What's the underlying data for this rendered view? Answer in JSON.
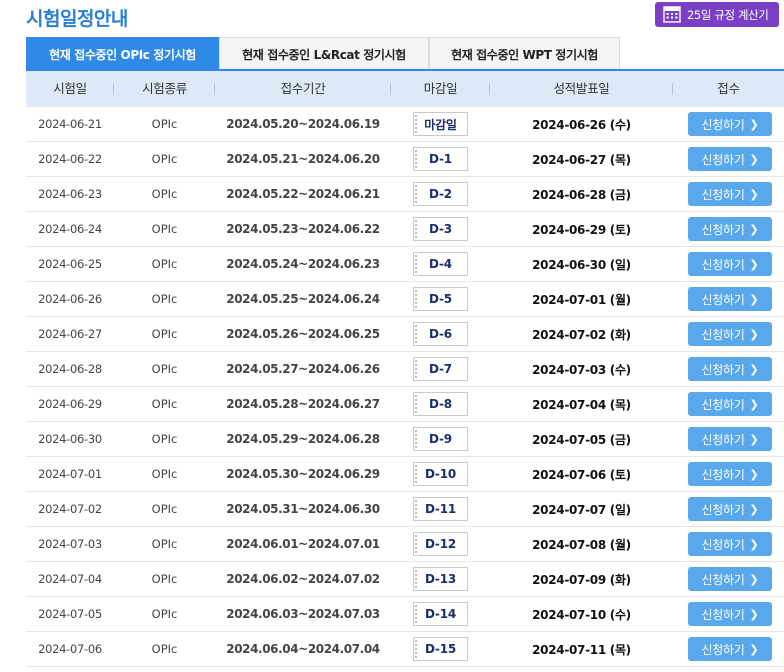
{
  "page": {
    "title": "시험일정안내",
    "calc_button": "25일 규정 계산기"
  },
  "colors": {
    "accent": "#2e8ae6",
    "calc_button": "#7a3fc4",
    "apply_button": "#59a8ec",
    "header_bg": "#dde9f7"
  },
  "tabs": [
    {
      "label": "현재 접수중인 OPIc 정기시험",
      "active": true
    },
    {
      "label": "현재 접수중인 L&Rcat 정기시험",
      "active": false
    },
    {
      "label": "현재 접수중인 WPT 정기시험",
      "active": false
    }
  ],
  "table": {
    "headers": [
      "시험일",
      "시험종류",
      "접수기간",
      "마감일",
      "성적발표일",
      "접수"
    ],
    "apply_label": "신청하기",
    "rows": [
      {
        "date": "2024-06-21",
        "type": "OPIc",
        "period": "2024.05.20~2024.06.19",
        "deadline": "마감일",
        "result": "2024-06-26 (수)"
      },
      {
        "date": "2024-06-22",
        "type": "OPIc",
        "period": "2024.05.21~2024.06.20",
        "deadline": "D-1",
        "result": "2024-06-27 (목)"
      },
      {
        "date": "2024-06-23",
        "type": "OPIc",
        "period": "2024.05.22~2024.06.21",
        "deadline": "D-2",
        "result": "2024-06-28 (금)"
      },
      {
        "date": "2024-06-24",
        "type": "OPIc",
        "period": "2024.05.23~2024.06.22",
        "deadline": "D-3",
        "result": "2024-06-29 (토)"
      },
      {
        "date": "2024-06-25",
        "type": "OPIc",
        "period": "2024.05.24~2024.06.23",
        "deadline": "D-4",
        "result": "2024-06-30 (일)"
      },
      {
        "date": "2024-06-26",
        "type": "OPIc",
        "period": "2024.05.25~2024.06.24",
        "deadline": "D-5",
        "result": "2024-07-01 (월)"
      },
      {
        "date": "2024-06-27",
        "type": "OPIc",
        "period": "2024.05.26~2024.06.25",
        "deadline": "D-6",
        "result": "2024-07-02 (화)"
      },
      {
        "date": "2024-06-28",
        "type": "OPIc",
        "period": "2024.05.27~2024.06.26",
        "deadline": "D-7",
        "result": "2024-07-03 (수)"
      },
      {
        "date": "2024-06-29",
        "type": "OPIc",
        "period": "2024.05.28~2024.06.27",
        "deadline": "D-8",
        "result": "2024-07-04 (목)"
      },
      {
        "date": "2024-06-30",
        "type": "OPIc",
        "period": "2024.05.29~2024.06.28",
        "deadline": "D-9",
        "result": "2024-07-05 (금)"
      },
      {
        "date": "2024-07-01",
        "type": "OPIc",
        "period": "2024.05.30~2024.06.29",
        "deadline": "D-10",
        "result": "2024-07-06 (토)"
      },
      {
        "date": "2024-07-02",
        "type": "OPIc",
        "period": "2024.05.31~2024.06.30",
        "deadline": "D-11",
        "result": "2024-07-07 (일)"
      },
      {
        "date": "2024-07-03",
        "type": "OPIc",
        "period": "2024.06.01~2024.07.01",
        "deadline": "D-12",
        "result": "2024-07-08 (월)"
      },
      {
        "date": "2024-07-04",
        "type": "OPIc",
        "period": "2024.06.02~2024.07.02",
        "deadline": "D-13",
        "result": "2024-07-09 (화)"
      },
      {
        "date": "2024-07-05",
        "type": "OPIc",
        "period": "2024.06.03~2024.07.03",
        "deadline": "D-14",
        "result": "2024-07-10 (수)"
      },
      {
        "date": "2024-07-06",
        "type": "OPIc",
        "period": "2024.06.04~2024.07.04",
        "deadline": "D-15",
        "result": "2024-07-11 (목)"
      }
    ]
  }
}
